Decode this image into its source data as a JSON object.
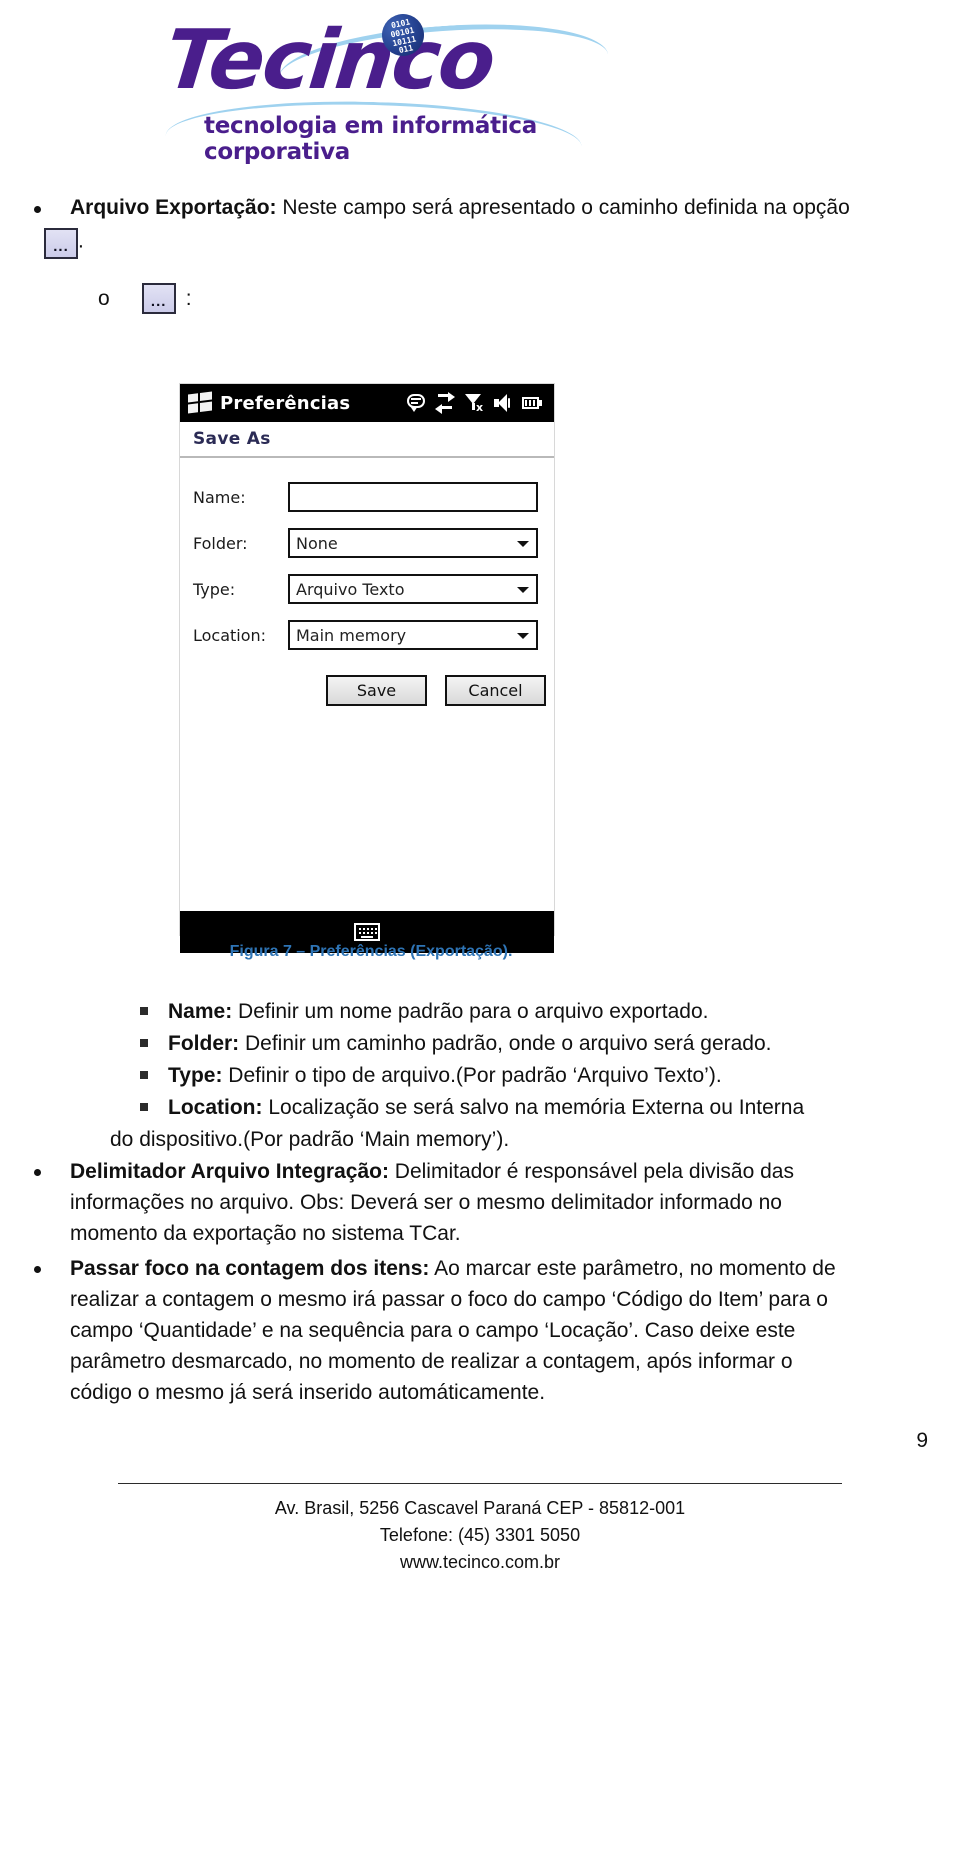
{
  "brand": {
    "logo_text": "Tecinco",
    "tagline": "tecnologia em informática corporativa",
    "binary_rows": [
      "0101",
      "00101",
      "10111",
      "011"
    ],
    "accent_purple": "#4a1e8c",
    "accent_blue": "#9fd2ef",
    "ball_blue": "#24418f"
  },
  "content": {
    "bullet1_label": "Arquivo Exportação:",
    "bullet1_text": " Neste campo será apresentado o caminho definida na opção",
    "dots_label": "...",
    "dots_period": ".",
    "sub_bullet_marker": "o",
    "sub_bullet_colon": ":"
  },
  "device": {
    "title": "Preferências",
    "subheader": "Save As",
    "icons": [
      "windows-flag-icon",
      "chat-icon",
      "sync-icon",
      "signal-off-icon",
      "speaker-icon",
      "battery-icon"
    ],
    "fields": [
      {
        "label": "Name:",
        "value": "",
        "type": "text"
      },
      {
        "label": "Folder:",
        "value": "None",
        "type": "dropdown"
      },
      {
        "label": "Type:",
        "value": "Arquivo Texto",
        "type": "dropdown"
      },
      {
        "label": "Location:",
        "value": "Main memory",
        "type": "dropdown"
      }
    ],
    "save_label": "Save",
    "cancel_label": "Cancel",
    "keyboard_icon": "keyboard-icon"
  },
  "figure": {
    "caption": "Figura 7 – Preferências (Exportação)."
  },
  "options": [
    {
      "label": "Name:",
      "text": " Definir um nome padrão para o arquivo exportado."
    },
    {
      "label": "Folder:",
      "text": " Definir um caminho padrão, onde o arquivo será gerado."
    },
    {
      "label": "Type:",
      "text": " Definir o tipo de arquivo.(Por padrão ‘Arquivo Texto’)."
    },
    {
      "label": "Location:",
      "text": " Localização se será salvo na memória Externa ou Interna",
      "text2": "do dispositivo.(Por padrão ‘Main memory’)."
    }
  ],
  "paragraphs": [
    {
      "label": "Delimitador Arquivo Integração:",
      "lines": [
        " Delimitador é responsável pela divisão das",
        "informações no arquivo.  Obs: Deverá ser o mesmo delimitador informado no",
        "momento da exportação no sistema TCar."
      ]
    },
    {
      "label": "Passar foco na contagem dos itens:",
      "lines": [
        " Ao marcar este parâmetro, no momento de",
        "realizar a contagem o mesmo irá passar o foco do campo ‘Código do Item’ para o",
        "campo ‘Quantidade’ e na sequência para o campo ‘Locação’. Caso deixe este",
        "parâmetro desmarcado, no momento de realizar a contagem, após informar o",
        "código o mesmo já será inserido automáticamente."
      ]
    }
  ],
  "page_number": "9",
  "footer": {
    "line1": "Av. Brasil, 5256  Cascavel  Paraná  CEP - 85812-001",
    "line2": "Telefone: (45) 3301 5050",
    "line3": "www.tecinco.com.br"
  }
}
